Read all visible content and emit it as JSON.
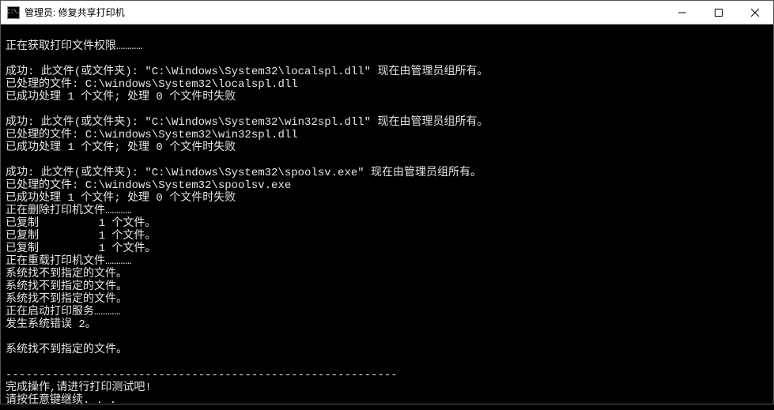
{
  "titlebar": {
    "icon_text": "C:\\.",
    "title": "管理员: 修复共享打印机"
  },
  "terminal": {
    "lines": [
      "",
      "正在获取打印文件权限…………",
      "",
      "成功: 此文件(或文件夹): \"C:\\Windows\\System32\\localspl.dll\" 现在由管理员组所有。",
      "已处理的文件: C:\\windows\\System32\\localspl.dll",
      "已成功处理 1 个文件; 处理 0 个文件时失败",
      "",
      "成功: 此文件(或文件夹): \"C:\\Windows\\System32\\win32spl.dll\" 现在由管理员组所有。",
      "已处理的文件: C:\\windows\\System32\\win32spl.dll",
      "已成功处理 1 个文件; 处理 0 个文件时失败",
      "",
      "成功: 此文件(或文件夹): \"C:\\Windows\\System32\\spoolsv.exe\" 现在由管理员组所有。",
      "已处理的文件: C:\\windows\\System32\\spoolsv.exe",
      "已成功处理 1 个文件; 处理 0 个文件时失败",
      "正在删除打印机文件…………",
      "已复制         1 个文件。",
      "已复制         1 个文件。",
      "已复制         1 个文件。",
      "正在重载打印机文件…………",
      "系统找不到指定的文件。",
      "系统找不到指定的文件。",
      "系统找不到指定的文件。",
      "正在启动打印服务…………",
      "发生系统错误 2。",
      "",
      "系统找不到指定的文件。",
      "",
      "-----------------------------------------------------------",
      "完成操作,请进行打印测试吧!",
      "请按任意键继续. . ."
    ]
  }
}
